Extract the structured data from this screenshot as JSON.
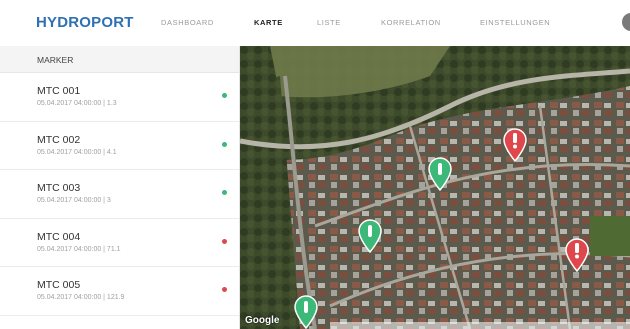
{
  "header": {
    "logo": "HYDROPORT",
    "nav": [
      {
        "label": "DASHBOARD"
      },
      {
        "label": "KARTE",
        "active": true
      },
      {
        "label": "LISTE"
      },
      {
        "label": "KORRELATION"
      },
      {
        "label": "EINSTELLUNGEN"
      }
    ]
  },
  "sidebar": {
    "title": "MARKER",
    "items": [
      {
        "name": "MTC 001",
        "meta": "05.04.2017 04:00:00 | 1.3",
        "status": "ok",
        "status_color": "#3cb878"
      },
      {
        "name": "MTC 002",
        "meta": "05.04.2017 04:00:00 | 4.1",
        "status": "ok",
        "status_color": "#3cb878"
      },
      {
        "name": "MTC 003",
        "meta": "05.04.2017 04:00:00 | 3",
        "status": "ok",
        "status_color": "#3cb878"
      },
      {
        "name": "MTC 004",
        "meta": "05.04.2017 04:00:00 | 71.1",
        "status": "alert",
        "status_color": "#e0474c"
      },
      {
        "name": "MTC 005",
        "meta": "05.04.2017 04:00:00 | 121.9",
        "status": "alert",
        "status_color": "#e0474c"
      }
    ]
  },
  "map": {
    "attribution": "Google",
    "pins": [
      {
        "status": "ok",
        "color": "#3cb878",
        "icon": "status-ok-icon"
      },
      {
        "status": "ok",
        "color": "#3cb878",
        "icon": "status-ok-icon"
      },
      {
        "status": "ok",
        "color": "#3cb878",
        "icon": "status-ok-icon"
      },
      {
        "status": "alert",
        "color": "#e0474c",
        "icon": "exclamation-icon"
      },
      {
        "status": "alert",
        "color": "#e0474c",
        "icon": "exclamation-icon"
      }
    ]
  },
  "colors": {
    "brand": "#2f6fb3",
    "ok": "#3cb878",
    "alert": "#e0474c"
  }
}
